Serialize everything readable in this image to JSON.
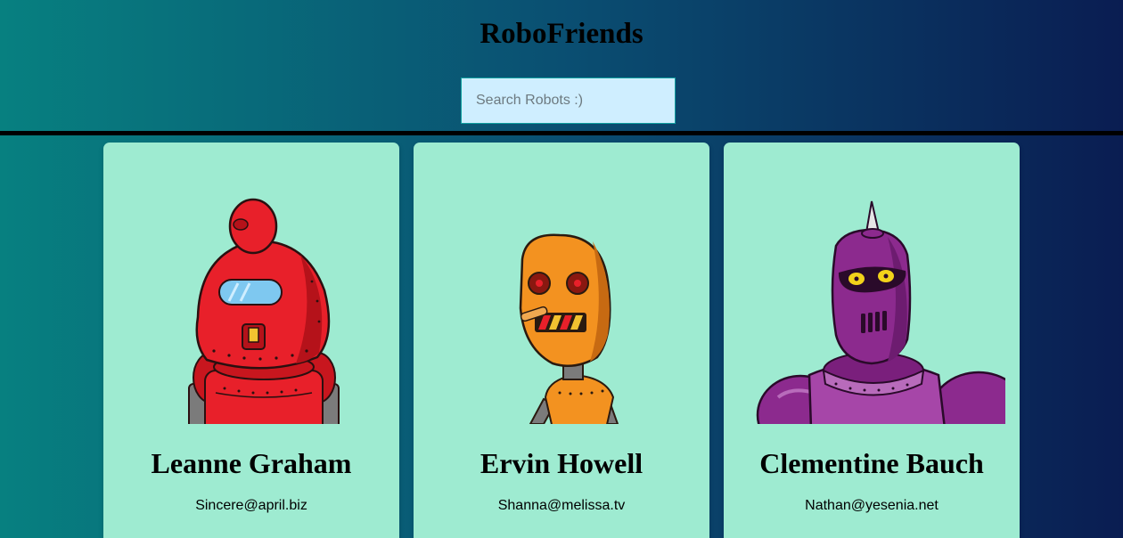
{
  "app": {
    "title": "RoboFriends"
  },
  "search": {
    "placeholder": "Search Robots :)",
    "value": ""
  },
  "robots": [
    {
      "name": "Leanne Graham",
      "email": "Sincere@april.biz",
      "color": "#e8202a"
    },
    {
      "name": "Ervin Howell",
      "email": "Shanna@melissa.tv",
      "color": "#f39220"
    },
    {
      "name": "Clementine Bauch",
      "email": "Nathan@yesenia.net",
      "color": "#8c2a8e"
    }
  ],
  "colors": {
    "card_background": "#9eebd1",
    "search_background": "#cfeeff",
    "gradient_start": "#078080",
    "gradient_end": "#0a1d52"
  }
}
